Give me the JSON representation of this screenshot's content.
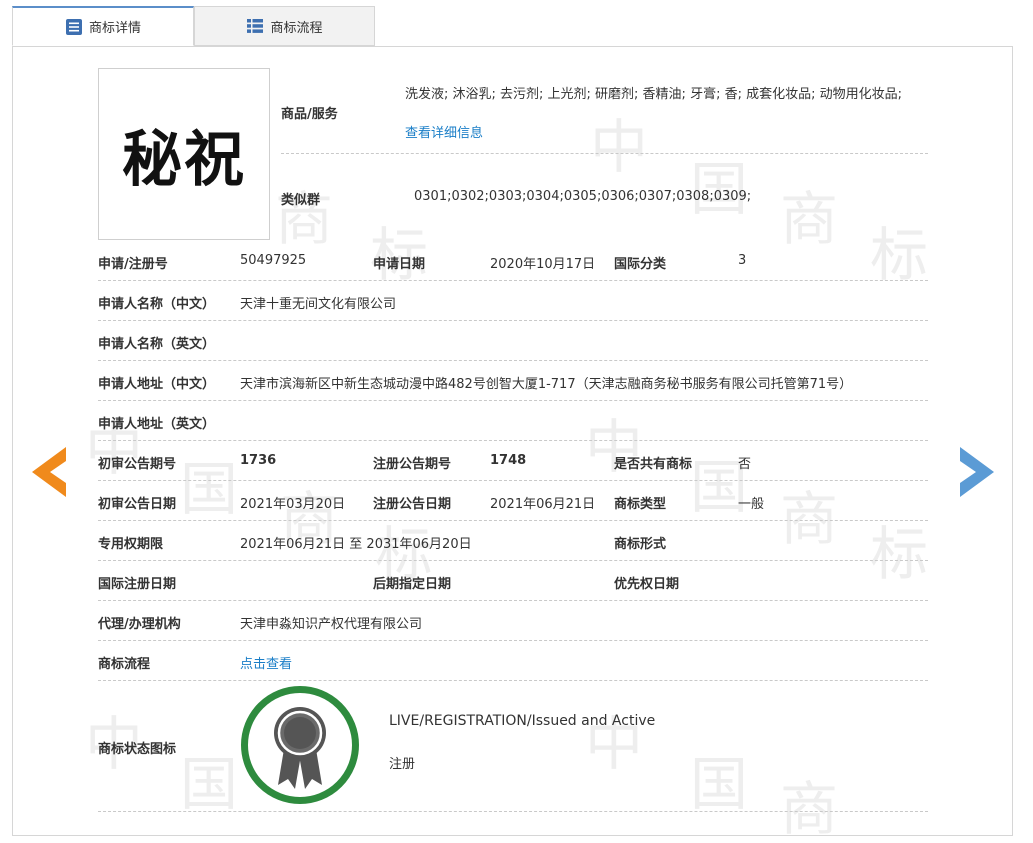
{
  "tabs": [
    {
      "label": "商标详情",
      "icon": "list-detail-icon"
    },
    {
      "label": "商标流程",
      "icon": "list-flow-icon"
    }
  ],
  "watermark_chars": [
    "中",
    "国",
    "商",
    "标"
  ],
  "logo_text": "秘祝",
  "goods": {
    "label": "商品/服务",
    "value": "洗发液; 沐浴乳; 去污剂; 上光剂; 研磨剂; 香精油; 牙膏; 香; 成套化妆品; 动物用化妆品;",
    "link": "查看详细信息"
  },
  "similar_group": {
    "label": "类似群",
    "value": "0301;0302;0303;0304;0305;0306;0307;0308;0309;"
  },
  "rows": {
    "reg_no_label": "申请/注册号",
    "reg_no": "50497925",
    "apply_date_label": "申请日期",
    "apply_date": "2020年10月17日",
    "intl_class_label": "国际分类",
    "intl_class": "3",
    "applicant_cn_label": "申请人名称（中文）",
    "applicant_cn": "天津十重无间文化有限公司",
    "applicant_en_label": "申请人名称（英文）",
    "applicant_en": "",
    "address_cn_label": "申请人地址（中文）",
    "address_cn": "天津市滨海新区中新生态城动漫中路482号创智大厦1-717（天津志融商务秘书服务有限公司托管第71号）",
    "address_en_label": "申请人地址（英文）",
    "address_en": "",
    "prelim_issue_label": "初审公告期号",
    "prelim_issue": "1736",
    "reg_issue_label": "注册公告期号",
    "reg_issue": "1748",
    "shared_label": "是否共有商标",
    "shared": "否",
    "prelim_date_label": "初审公告日期",
    "prelim_date": "2021年03月20日",
    "reg_date_label": "注册公告日期",
    "reg_date": "2021年06月21日",
    "tm_type_label": "商标类型",
    "tm_type": "一般",
    "term_label": "专用权期限",
    "term": "2021年06月21日 至 2031年06月20日",
    "tm_form_label": "商标形式",
    "tm_form": "",
    "intl_reg_date_label": "国际注册日期",
    "intl_reg_date": "",
    "later_date_label": "后期指定日期",
    "later_date": "",
    "priority_date_label": "优先权日期",
    "priority_date": "",
    "agent_label": "代理/办理机构",
    "agent": "天津申淼知识产权代理有限公司",
    "process_label": "商标流程",
    "process_link": "点击查看",
    "status_label": "商标状态图标",
    "status_en": "LIVE/REGISTRATION/Issued and Active",
    "status_cn": "注册"
  },
  "colors": {
    "link": "#1a7ec7",
    "prev_arrow": "#f08a1c",
    "next_arrow": "#5b9bd5",
    "status_ring": "#2e8b3e",
    "medal": "#555555"
  },
  "nav": {
    "prev_icon": "chevron-left-icon",
    "next_icon": "chevron-right-icon"
  }
}
